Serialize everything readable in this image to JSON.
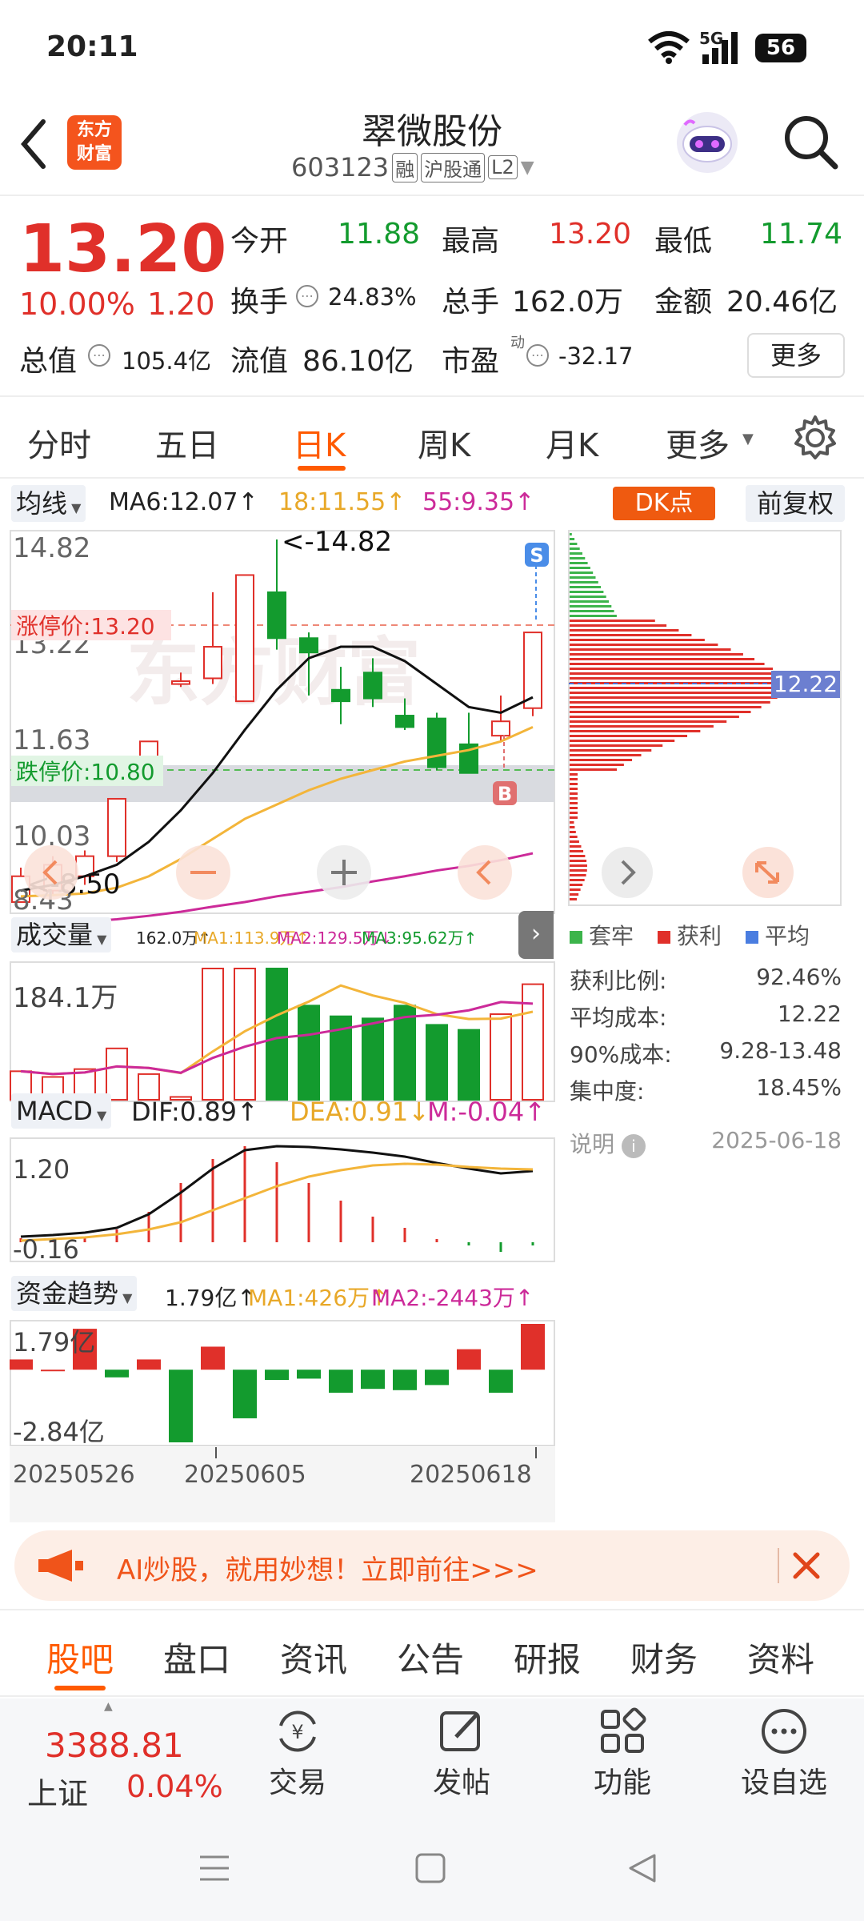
{
  "status": {
    "time": "20:11",
    "network": "5G",
    "battery": "56"
  },
  "header": {
    "logo_line1": "东方",
    "logo_line2": "财富",
    "stock_name": "翠微股份",
    "stock_code": "603123",
    "tag_margin": "融",
    "tag_connect": "沪股通",
    "tag_level": "L2"
  },
  "quote": {
    "price": "13.20",
    "change_pct": "10.00%",
    "change_amt": "1.20",
    "open_label": "今开",
    "open": "11.88",
    "high_label": "最高",
    "high": "13.20",
    "low_label": "最低",
    "low": "11.74",
    "turnover_label": "换手",
    "turnover": "24.83%",
    "vol_label": "总手",
    "vol": "162.0万",
    "amount_label": "金额",
    "amount": "20.46亿",
    "mktcap_label": "总值",
    "mktcap": "105.4亿",
    "float_label": "流值",
    "float": "86.10亿",
    "pe_label": "市盈",
    "pe_sup": "动",
    "pe": "-32.17",
    "more": "更多"
  },
  "tabs": [
    "分时",
    "五日",
    "日K",
    "周K",
    "月K",
    "更多"
  ],
  "active_tab": "日K",
  "kline": {
    "indicator_select": "均线",
    "ma6": "MA6:12.07↑",
    "ma18": "18:11.55↑",
    "ma55": "55:9.35↑",
    "dk_button": "DK点",
    "adjust_button": "前复权",
    "y_labels": [
      "14.82",
      "13.22",
      "11.63",
      "10.03",
      "8.43"
    ],
    "limit_up": "涨停价:13.20",
    "limit_down": "跌停价:10.80",
    "max_note": "<-14.82",
    "min_note": "<-8.50",
    "sell_marker": "S",
    "buy_marker": "B",
    "watermark": "东方财富"
  },
  "chip": {
    "current_cost": "12.22",
    "legend": [
      "套牢",
      "获利",
      "平均"
    ],
    "rows": [
      {
        "label": "获利比例:",
        "value": "92.46%"
      },
      {
        "label": "平均成本:",
        "value": "12.22"
      },
      {
        "label": "90%成本:",
        "value": "9.28-13.48"
      },
      {
        "label": "集中度:",
        "value": "18.45%"
      }
    ],
    "note_label": "说明",
    "date": "2025-06-18"
  },
  "volume": {
    "select": "成交量",
    "v": "162.0万↑",
    "ma1": "MA1:113.9万↑",
    "ma2": "MA2:129.5万↓",
    "ma3": "MA3:95.62万↑",
    "y_top": "184.1万"
  },
  "macd": {
    "select": "MACD",
    "dif": "DIF:0.89↑",
    "dea": "DEA:0.91↓",
    "m": "M:-0.04↑",
    "y_top": "1.20",
    "y_bottom": "-0.16"
  },
  "fund": {
    "select": "资金趋势",
    "v": "1.79亿↑",
    "ma1": "MA1:426万↑",
    "ma2": "MA2:-2443万↑",
    "y_top": "1.79亿",
    "y_bottom": "-2.84亿"
  },
  "dates": [
    "20250526",
    "20250605",
    "20250618"
  ],
  "chart_data": {
    "type": "candlestick",
    "candles": [
      {
        "o": 8.5,
        "h": 9.1,
        "l": 8.5,
        "c": 8.95
      },
      {
        "o": 8.7,
        "h": 9.3,
        "l": 8.6,
        "c": 9.15
      },
      {
        "o": 8.95,
        "h": 9.4,
        "l": 8.8,
        "c": 9.3
      },
      {
        "o": 9.3,
        "h": 10.3,
        "l": 9.2,
        "c": 10.3
      },
      {
        "o": 11.0,
        "h": 11.3,
        "l": 10.9,
        "c": 11.3
      },
      {
        "o": 12.3,
        "h": 12.5,
        "l": 12.25,
        "c": 12.35
      },
      {
        "o": 12.4,
        "h": 13.9,
        "l": 12.3,
        "c": 12.95
      },
      {
        "o": 12.0,
        "h": 14.2,
        "l": 12.0,
        "c": 14.2
      },
      {
        "o": 13.9,
        "h": 14.82,
        "l": 12.9,
        "c": 13.1
      },
      {
        "o": 13.1,
        "h": 13.2,
        "l": 12.1,
        "c": 12.85
      },
      {
        "o": 12.2,
        "h": 12.6,
        "l": 11.6,
        "c": 12.0
      },
      {
        "o": 12.5,
        "h": 12.75,
        "l": 11.9,
        "c": 12.05
      },
      {
        "o": 11.75,
        "h": 12.05,
        "l": 11.5,
        "c": 11.55
      },
      {
        "o": 11.7,
        "h": 11.8,
        "l": 10.8,
        "c": 10.85
      },
      {
        "o": 11.25,
        "h": 11.8,
        "l": 10.8,
        "c": 10.75
      },
      {
        "o": 11.4,
        "h": 12.1,
        "l": 11.3,
        "c": 11.65
      },
      {
        "o": 11.88,
        "h": 13.2,
        "l": 11.74,
        "c": 13.2
      }
    ],
    "ma6": [
      8.7,
      8.8,
      8.95,
      9.15,
      9.55,
      10.1,
      10.75,
      11.5,
      12.2,
      12.75,
      12.95,
      12.95,
      12.7,
      12.3,
      11.9,
      11.8,
      12.07
    ],
    "ma18": [
      8.6,
      8.62,
      8.65,
      8.75,
      8.95,
      9.25,
      9.6,
      9.95,
      10.2,
      10.45,
      10.65,
      10.8,
      10.95,
      11.05,
      11.15,
      11.3,
      11.55
    ],
    "ma55": [
      8.1,
      8.13,
      8.16,
      8.2,
      8.26,
      8.33,
      8.42,
      8.5,
      8.6,
      8.68,
      8.76,
      8.86,
      8.95,
      9.05,
      9.13,
      9.23,
      9.35
    ],
    "volume": [
      22,
      40,
      32,
      43,
      72,
      36,
      4,
      184,
      184,
      184,
      132,
      117,
      114,
      132,
      105,
      98,
      120,
      162
    ],
    "macd_dif": [
      0.07,
      0.09,
      0.12,
      0.18,
      0.35,
      0.62,
      0.92,
      1.15,
      1.2,
      1.19,
      1.16,
      1.12,
      1.07,
      0.99,
      0.92,
      0.86,
      0.89
    ],
    "macd_dea": [
      0.02,
      0.04,
      0.06,
      0.1,
      0.16,
      0.25,
      0.4,
      0.55,
      0.7,
      0.82,
      0.9,
      0.96,
      0.98,
      0.97,
      0.94,
      0.92,
      0.91
    ],
    "macd_m": [
      0.05,
      0.05,
      0.06,
      0.16,
      0.38,
      0.74,
      1.04,
      1.2,
      1.0,
      0.74,
      0.52,
      0.32,
      0.18,
      0.04,
      -0.04,
      -0.12,
      -0.04
    ],
    "fund_flow": [
      0.4,
      0.0,
      1.6,
      -0.3,
      0.4,
      -2.84,
      0.9,
      -1.9,
      -0.4,
      -0.35,
      -0.9,
      -0.75,
      -0.8,
      -0.6,
      0.8,
      -0.9,
      1.79
    ]
  },
  "promo": {
    "text": "AI炒股，就用妙想！立即前往>>>"
  },
  "bottom_tabs": [
    "股吧",
    "盘口",
    "资讯",
    "公告",
    "研报",
    "财务",
    "资料"
  ],
  "dock": {
    "index_value": "3388.81",
    "index_name": "上证",
    "index_change": "0.04%",
    "trade": "交易",
    "post": "发帖",
    "function": "功能",
    "watchlist": "设自选"
  },
  "colors": {
    "up": "#e0302a",
    "down": "#139b2e",
    "accent": "#ff6a13",
    "ma6": "#111111",
    "ma18": "#f3b53a",
    "ma55": "#cc2a99"
  }
}
